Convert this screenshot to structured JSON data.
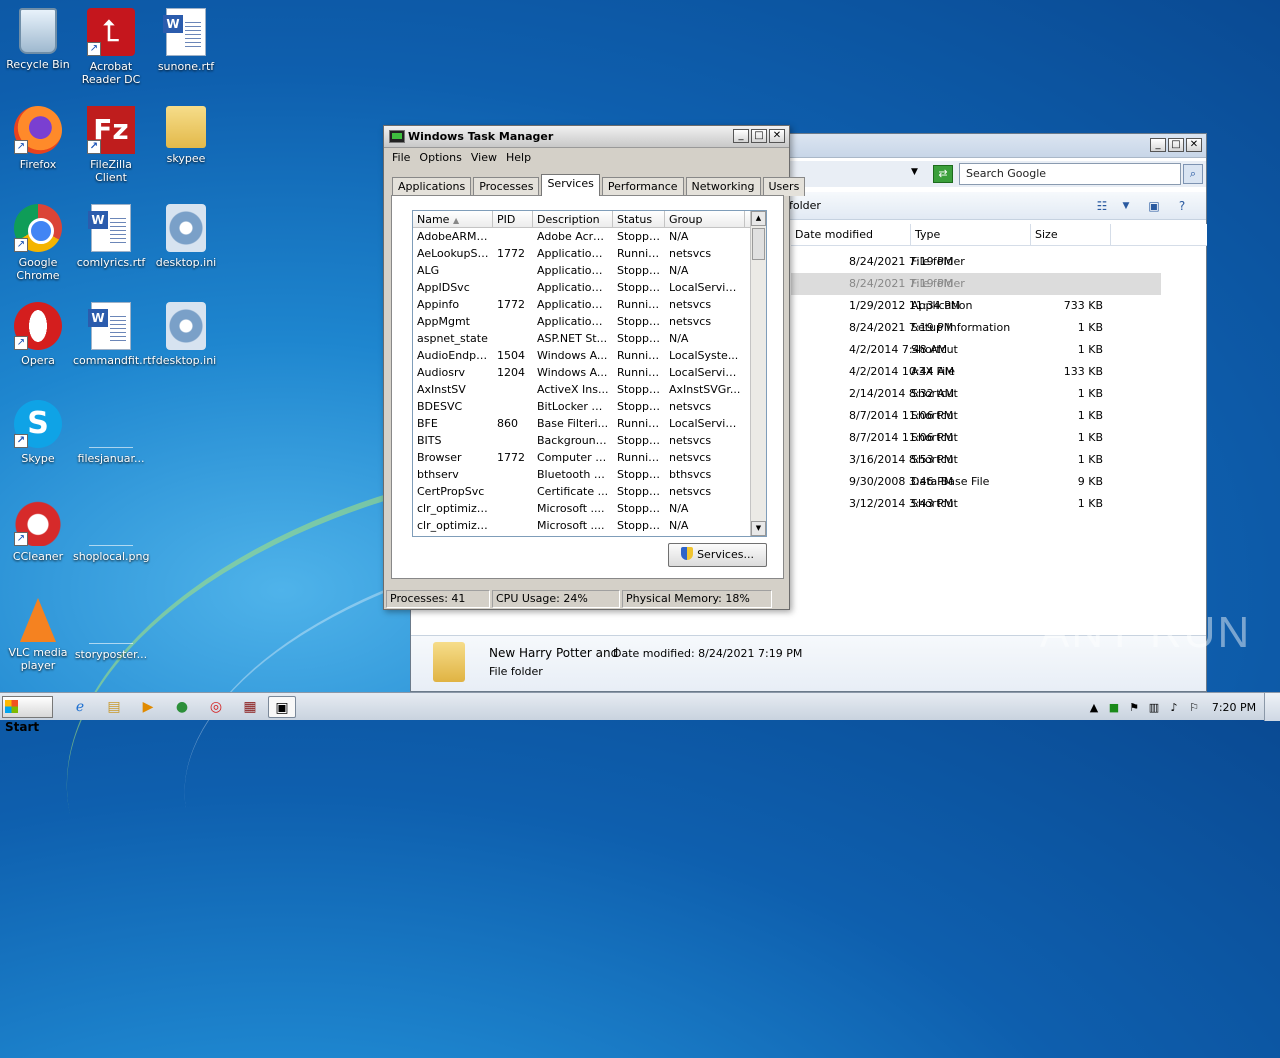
{
  "desktop": {
    "icons": [
      {
        "label": "Recycle Bin"
      },
      {
        "label": "Acrobat Reader DC"
      },
      {
        "label": "sunone.rtf"
      },
      {
        "label": "Firefox"
      },
      {
        "label": "FileZilla Client"
      },
      {
        "label": "skypee"
      },
      {
        "label": "Google Chrome"
      },
      {
        "label": "comlyrics.rtf"
      },
      {
        "label": "desktop.ini"
      },
      {
        "label": "Opera"
      },
      {
        "label": "commandfit.rtf"
      },
      {
        "label": "desktop.ini"
      },
      {
        "label": "Skype"
      },
      {
        "label": "filesjanuar..."
      },
      {
        "label": "CCleaner"
      },
      {
        "label": "shoplocal.png"
      },
      {
        "label": "VLC media player"
      },
      {
        "label": "storyposter..."
      }
    ]
  },
  "explorer": {
    "search_placeholder": "Search Google",
    "breadcrumb": "folder",
    "columns": [
      "Date modified",
      "Type",
      "Size"
    ],
    "rows": [
      {
        "date": "8/24/2021 7:19 PM",
        "type": "File folder",
        "size": ""
      },
      {
        "date": "8/24/2021 7:19 PM",
        "type": "File folder",
        "size": ""
      },
      {
        "date": "1/29/2012 11:34 PM",
        "type": "Application",
        "size": "733 KB"
      },
      {
        "date": "8/24/2021 7:19 PM",
        "type": "Setup Information",
        "size": "1 KB"
      },
      {
        "date": "4/2/2014 7:48 AM",
        "type": "Shortcut",
        "size": "1 KB"
      },
      {
        "date": "4/2/2014 10:44 AM",
        "type": "A3X File",
        "size": "133 KB"
      },
      {
        "date": "2/14/2014 8:32 AM",
        "type": "Shortcut",
        "size": "1 KB"
      },
      {
        "date": "8/7/2014 11:06 PM",
        "type": "Shortcut",
        "size": "1 KB"
      },
      {
        "date": "8/7/2014 11:06 PM",
        "type": "Shortcut",
        "size": "1 KB"
      },
      {
        "date": "3/16/2014 8:53 PM",
        "type": "Shortcut",
        "size": "1 KB"
      },
      {
        "date": "9/30/2008 3:46 PM",
        "type": "Data Base File",
        "size": "9 KB"
      },
      {
        "date": "3/12/2014 3:43 PM",
        "type": "Shortcut",
        "size": "1 KB"
      }
    ],
    "details": {
      "name": "New Harry Potter and",
      "modified": "Date modified: 8/24/2021 7:19 PM",
      "type": "File folder"
    }
  },
  "taskmanager": {
    "title": "Windows Task Manager",
    "menu": [
      "File",
      "Options",
      "View",
      "Help"
    ],
    "tabs": [
      "Applications",
      "Processes",
      "Services",
      "Performance",
      "Networking",
      "Users"
    ],
    "active_tab": "Services",
    "columns": [
      "Name",
      "PID",
      "Description",
      "Status",
      "Group"
    ],
    "services": [
      {
        "name": "AdobeARMs...",
        "pid": "",
        "desc": "Adobe Acro...",
        "status": "Stopped",
        "group": "N/A"
      },
      {
        "name": "AeLookupSvc",
        "pid": "1772",
        "desc": "Application ...",
        "status": "Running",
        "group": "netsvcs"
      },
      {
        "name": "ALG",
        "pid": "",
        "desc": "Application ...",
        "status": "Stopped",
        "group": "N/A"
      },
      {
        "name": "AppIDSvc",
        "pid": "",
        "desc": "Application ...",
        "status": "Stopped",
        "group": "LocalServic..."
      },
      {
        "name": "Appinfo",
        "pid": "1772",
        "desc": "Application ...",
        "status": "Running",
        "group": "netsvcs"
      },
      {
        "name": "AppMgmt",
        "pid": "",
        "desc": "Application ...",
        "status": "Stopped",
        "group": "netsvcs"
      },
      {
        "name": "aspnet_state",
        "pid": "",
        "desc": "ASP.NET St...",
        "status": "Stopped",
        "group": "N/A"
      },
      {
        "name": "AudioEndpoi...",
        "pid": "1504",
        "desc": "Windows A...",
        "status": "Running",
        "group": "LocalSyste..."
      },
      {
        "name": "Audiosrv",
        "pid": "1204",
        "desc": "Windows A...",
        "status": "Running",
        "group": "LocalServic..."
      },
      {
        "name": "AxInstSV",
        "pid": "",
        "desc": "ActiveX Ins...",
        "status": "Stopped",
        "group": "AxInstSVGr..."
      },
      {
        "name": "BDESVC",
        "pid": "",
        "desc": "BitLocker D...",
        "status": "Stopped",
        "group": "netsvcs"
      },
      {
        "name": "BFE",
        "pid": "860",
        "desc": "Base Filteri...",
        "status": "Running",
        "group": "LocalServic..."
      },
      {
        "name": "BITS",
        "pid": "",
        "desc": "Background...",
        "status": "Stopped",
        "group": "netsvcs"
      },
      {
        "name": "Browser",
        "pid": "1772",
        "desc": "Computer B...",
        "status": "Running",
        "group": "netsvcs"
      },
      {
        "name": "bthserv",
        "pid": "",
        "desc": "Bluetooth S...",
        "status": "Stopped",
        "group": "bthsvcs"
      },
      {
        "name": "CertPropSvc",
        "pid": "",
        "desc": "Certificate ...",
        "status": "Stopped",
        "group": "netsvcs"
      },
      {
        "name": "clr_optimiza...",
        "pid": "",
        "desc": "Microsoft ....",
        "status": "Stopped",
        "group": "N/A"
      },
      {
        "name": "clr_optimiza...",
        "pid": "",
        "desc": "Microsoft ....",
        "status": "Stopped",
        "group": "N/A"
      }
    ],
    "services_button": "Services...",
    "status": {
      "processes": "Processes: 41",
      "cpu": "CPU Usage: 24%",
      "memory": "Physical Memory: 18%"
    }
  },
  "taskbar": {
    "start_label": "Start",
    "clock": "7:20 PM"
  },
  "watermark": "ANY RUN"
}
